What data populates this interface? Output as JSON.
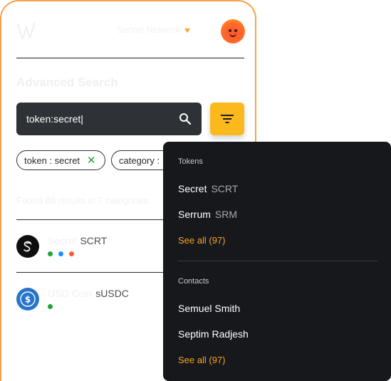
{
  "header": {
    "network": "Secret Network",
    "avatar_icon": "avatar-face-icon",
    "logo_icon": "wallet-logo-icon"
  },
  "page": {
    "title": "Advanced Search"
  },
  "search": {
    "value": "token:secret|",
    "placeholder": ""
  },
  "filters": [
    {
      "label": "token : secret",
      "remove": "✕"
    },
    {
      "label": "category :"
    }
  ],
  "results": {
    "summary": "Found 86 results in 7 categories",
    "items": [
      {
        "name": "Secret",
        "symbol": "SCRT",
        "dots": [
          "#22a33a",
          "#1e90ff",
          "#ff5a36"
        ]
      },
      {
        "name": "USD Coin",
        "symbol": "sUSDC",
        "dots": [
          "#22a33a"
        ]
      }
    ]
  },
  "dropdown": {
    "tokens_label": "Tokens",
    "tokens": [
      {
        "name": "Secret",
        "symbol": "SCRT"
      },
      {
        "name": "Serrum",
        "symbol": "SRM"
      }
    ],
    "tokens_see_all": "See all (97)",
    "contacts_label": "Contacts",
    "contacts": [
      {
        "name": "Semuel Smith"
      },
      {
        "name": "Septim Radjesh"
      }
    ],
    "contacts_see_all": "See all (97)"
  },
  "colors": {
    "accent": "#fbb91e",
    "panel": "#16181b",
    "success": "#22a33a"
  }
}
